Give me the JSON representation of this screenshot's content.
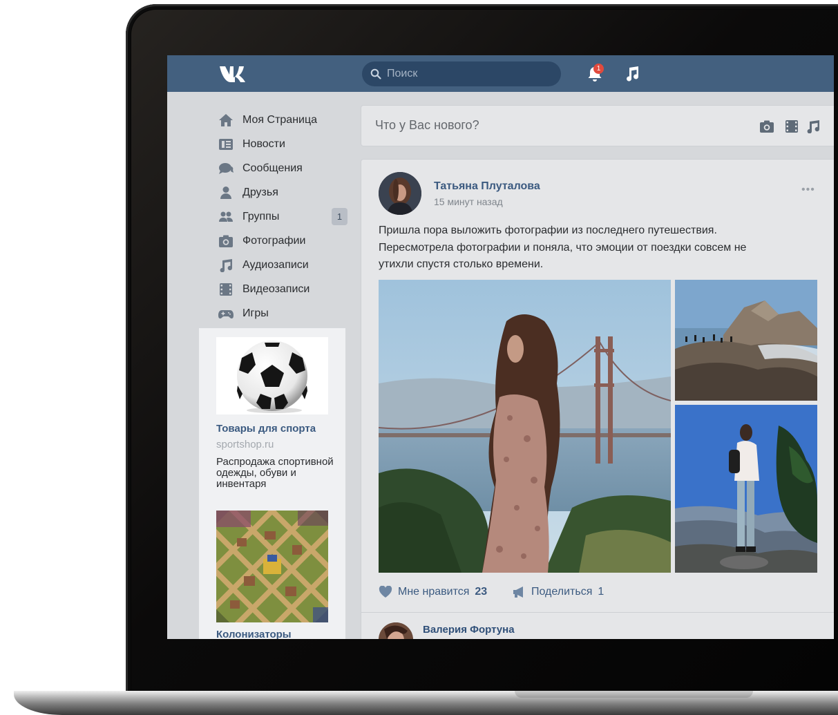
{
  "search": {
    "placeholder": "Поиск"
  },
  "header": {
    "notification_count": "1"
  },
  "nav": {
    "items": [
      {
        "label": "Моя Страница",
        "icon": "home-icon"
      },
      {
        "label": "Новости",
        "icon": "news-icon"
      },
      {
        "label": "Сообщения",
        "icon": "messages-icon"
      },
      {
        "label": "Друзья",
        "icon": "friends-icon"
      },
      {
        "label": "Группы",
        "icon": "groups-icon",
        "badge": "1"
      },
      {
        "label": "Фотографии",
        "icon": "camera-icon"
      },
      {
        "label": "Аудиозаписи",
        "icon": "music-icon"
      },
      {
        "label": "Видеозаписи",
        "icon": "video-icon"
      },
      {
        "label": "Игры",
        "icon": "gamepad-icon"
      }
    ]
  },
  "ads": {
    "ad1": {
      "title": "Товары для спорта",
      "domain": "sportshop.ru",
      "text": "Распродажа спортивной одежды, обуви и инвентаря"
    },
    "ad2": {
      "title": "Колонизаторы"
    }
  },
  "composer": {
    "placeholder": "Что у Вас нового?"
  },
  "post": {
    "author": "Татьяна Плуталова",
    "time": "15 минут назад",
    "text": "Пришла пора выложить фотографии из последнего путешествия. Пересмотрела фотографии и поняла, что эмоции от поездки совсем не утихли спустя столько времени.",
    "like_label": "Мне нравится",
    "like_count": "23",
    "share_label": "Поделиться",
    "share_count": "1"
  },
  "next_post": {
    "author": "Валерия Фортуна"
  },
  "colors": {
    "header": "#43607f",
    "search_bg": "#2c4766",
    "link": "#3b5a80",
    "page_bg": "#d6d8db",
    "card_bg": "#e5e6e8",
    "badge": "#e14a3d"
  }
}
